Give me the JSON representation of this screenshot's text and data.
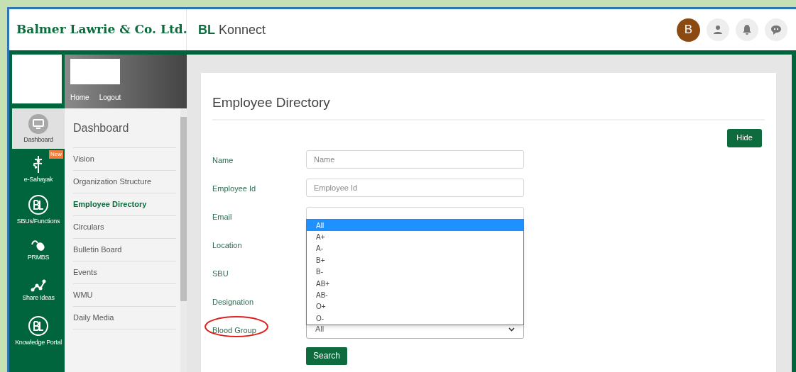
{
  "header": {
    "logo": "Balmer Lawrie & Co. Ltd.",
    "app_title": "**BL** Konnect",
    "avatar": "B"
  },
  "rail": [
    {
      "label": "Dashboard",
      "selected": true
    },
    {
      "label": "e-Sahayak",
      "selected": false,
      "badge": "New"
    },
    {
      "label": "SBUs/Functions",
      "selected": false
    },
    {
      "label": "PRMBS",
      "selected": false
    },
    {
      "label": "Share Ideas",
      "selected": false
    },
    {
      "label": "Knowledge Portal",
      "selected": false
    }
  ],
  "menu": {
    "links": [
      "Home",
      "Logout"
    ],
    "title": "Dashboard",
    "items": [
      {
        "label": "Vision",
        "selected": false
      },
      {
        "label": "Organization Structure",
        "selected": false
      },
      {
        "label": "Employee Directory",
        "selected": true
      },
      {
        "label": "Circulars",
        "selected": false
      },
      {
        "label": "Bulletin Board",
        "selected": false
      },
      {
        "label": "Events",
        "selected": false
      },
      {
        "label": "WMU",
        "selected": false
      },
      {
        "label": "Daily Media",
        "selected": false
      }
    ]
  },
  "form": {
    "title": "Employee Directory",
    "hide_button": "Hide",
    "fields": [
      {
        "label": "Name",
        "kind": "text",
        "placeholder": "Name"
      },
      {
        "label": "Employee Id",
        "kind": "text",
        "placeholder": "Employee Id"
      },
      {
        "label": "Email",
        "kind": "text"
      },
      {
        "label": "Location",
        "kind": "hidden"
      },
      {
        "label": "SBU",
        "kind": "hidden"
      },
      {
        "label": "Designation",
        "kind": "hidden"
      },
      {
        "label": "Blood Group",
        "kind": "select",
        "value": "All",
        "highlighted": true
      }
    ],
    "dropdown": [
      {
        "label": "All",
        "selected": true
      },
      {
        "label": "A+",
        "selected": false
      },
      {
        "label": "A-",
        "selected": false
      },
      {
        "label": "B+",
        "selected": false
      },
      {
        "label": "B-",
        "selected": false
      },
      {
        "label": "AB+",
        "selected": false
      },
      {
        "label": "AB-",
        "selected": false
      },
      {
        "label": "O+",
        "selected": false
      },
      {
        "label": "O-",
        "selected": false
      }
    ],
    "search_button": "Search"
  }
}
